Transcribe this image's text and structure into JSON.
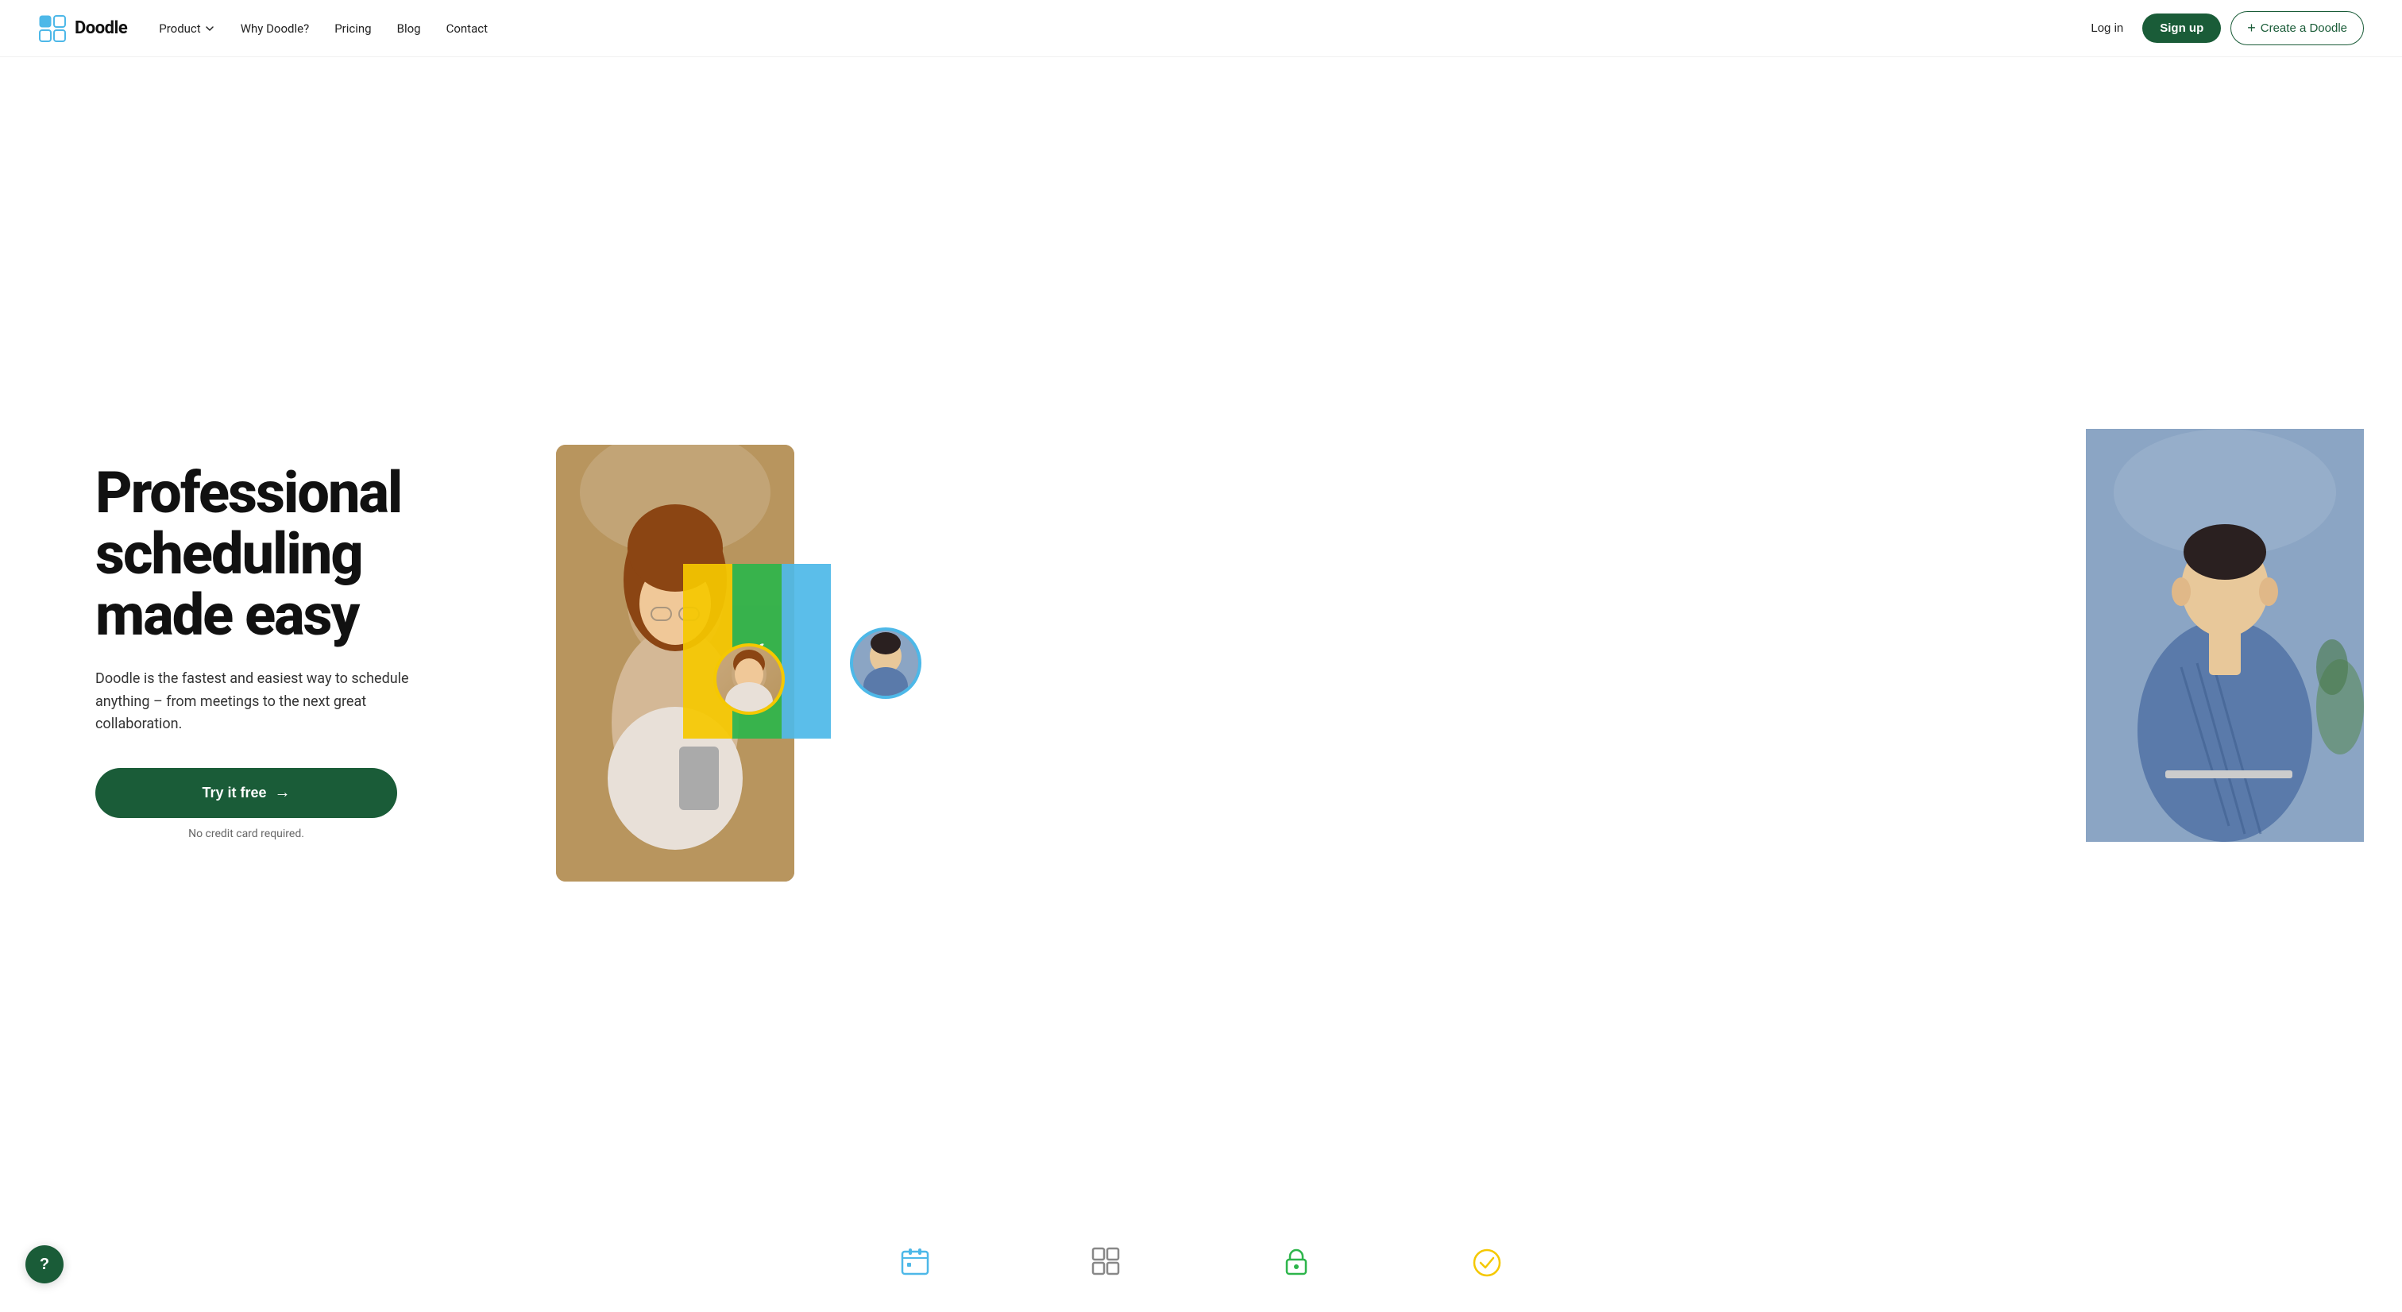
{
  "brand": {
    "name": "Doodle",
    "logo_alt": "Doodle logo"
  },
  "nav": {
    "links": [
      {
        "label": "Product",
        "has_dropdown": true
      },
      {
        "label": "Why Doodle?",
        "has_dropdown": false
      },
      {
        "label": "Pricing",
        "has_dropdown": false
      },
      {
        "label": "Blog",
        "has_dropdown": false
      },
      {
        "label": "Contact",
        "has_dropdown": false
      }
    ],
    "login_label": "Log in",
    "signup_label": "Sign up",
    "create_label": "Create a Doodle",
    "create_prefix": "+"
  },
  "hero": {
    "title": "Professional scheduling made easy",
    "subtitle": "Doodle is the fastest and easiest way to schedule anything – from meetings to the next great collaboration.",
    "cta_label": "Try it free",
    "cta_arrow": "→",
    "no_credit_text": "No credit card required."
  },
  "colors": {
    "brand_dark_green": "#1a5c38",
    "bar_yellow": "#f5c800",
    "bar_green": "#2db54b",
    "bar_blue": "#4db8e8"
  },
  "help": {
    "label": "?"
  }
}
